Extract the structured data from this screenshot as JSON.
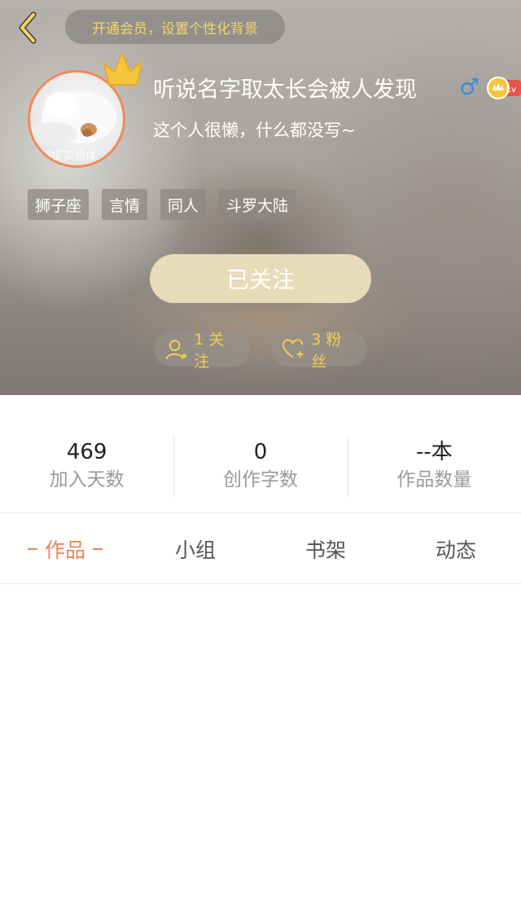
{
  "header": {
    "vip_banner": "开通会员，设置个性化背景",
    "nickname": "听说名字取太长会被人发现",
    "gender_symbol": "♂",
    "level_text": "Lv",
    "bio": "这个人很懒，什么都没写~",
    "avatar_caption": "捕捉实验体"
  },
  "tags": [
    "狮子座",
    "言情",
    "同人",
    "斗罗大陆"
  ],
  "follow_button": "已关注",
  "social": {
    "following": "1 关注",
    "fans": "3 粉丝"
  },
  "stats": [
    {
      "value": "469",
      "label": "加入天数"
    },
    {
      "value": "0",
      "label": "创作字数"
    },
    {
      "value": "--本",
      "label": "作品数量"
    }
  ],
  "tabs": [
    {
      "label": "作品",
      "active": true
    },
    {
      "label": "小组",
      "active": false
    },
    {
      "label": "书架",
      "active": false
    },
    {
      "label": "动态",
      "active": false
    }
  ],
  "colors": {
    "accent": "#e8845c",
    "vip_text": "#f5d46a",
    "follow_button": "#e7dbb9",
    "social_text": "#f6cf4a",
    "gender": "#3a8fd8"
  }
}
